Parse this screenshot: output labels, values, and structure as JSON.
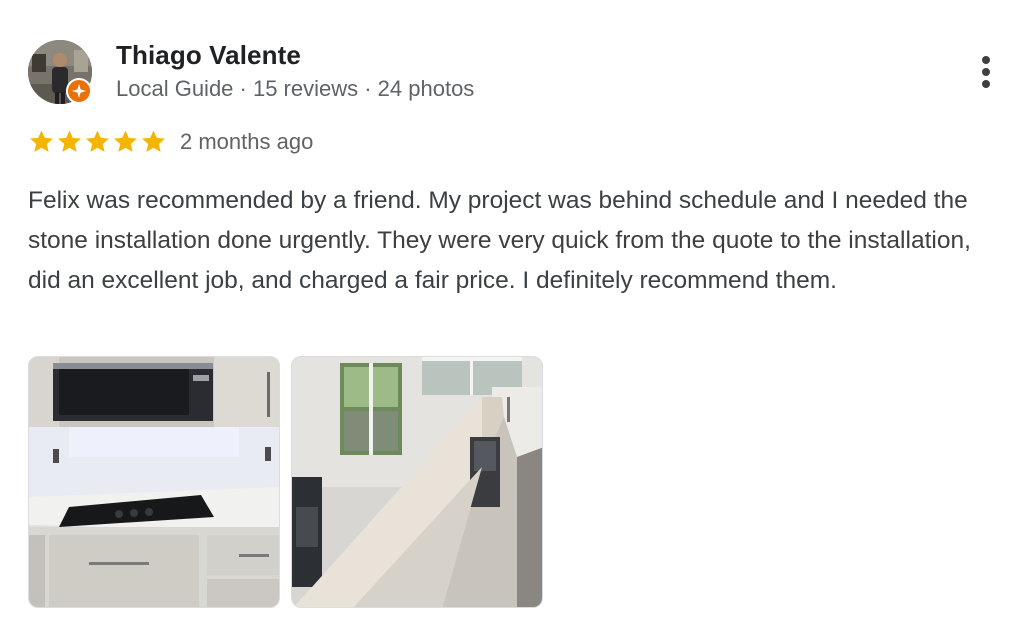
{
  "reviewer": {
    "name": "Thiago Valente",
    "meta": "Local Guide · 15 reviews · 24 photos"
  },
  "rating": {
    "stars": 5,
    "max": 5,
    "date": "2 months ago"
  },
  "review": {
    "text": "Felix was recommended by a friend. My project was behind schedule and I needed the stone installation done urgently. They were very quick from the quote to the installation, did an excellent job, and charged a fair price. I definitely recommend them."
  },
  "colors": {
    "star": "#f4b400",
    "guide_badge": "#e8710a",
    "name": "#202124",
    "meta": "#5f6368",
    "body_text": "#3c4043"
  },
  "icons": {
    "more": "more-vert-icon",
    "star": "star-icon",
    "badge": "local-guide-badge-icon"
  }
}
